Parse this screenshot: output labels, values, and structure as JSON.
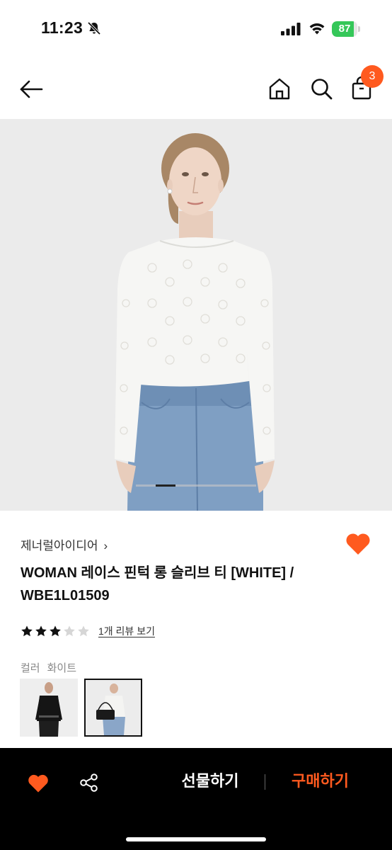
{
  "status_bar": {
    "time": "11:23",
    "battery": "87",
    "battery_level": 0.87,
    "icons": [
      "bell-slash-icon",
      "cellular-signal-icon",
      "wifi-icon",
      "battery-charging-icon"
    ]
  },
  "nav": {
    "cart_count": "3",
    "icons": [
      "back-arrow-icon",
      "home-icon",
      "search-icon",
      "shopping-bag-icon"
    ]
  },
  "product": {
    "brand": "제너럴아이디어",
    "brand_chevron": "›",
    "title": "WOMAN 레이스 핀턱 롱 슬리브 티 [WHITE] / WBE1L01509",
    "rating": 3,
    "rating_max": 5,
    "review_link": "1개 리뷰 보기",
    "color_label": "컬러",
    "color_value": "화이트",
    "carousel_position": 1
  },
  "bottom_bar": {
    "gift_label": "선물하기",
    "buy_label": "구매하기"
  },
  "colors": {
    "accent": "#ff5a1f",
    "star_filled": "#111111",
    "star_empty": "#d6d6d6",
    "battery_green": "#35c759",
    "bottom_bar_bg": "#000000",
    "hero_bg": "#ebebeb"
  }
}
